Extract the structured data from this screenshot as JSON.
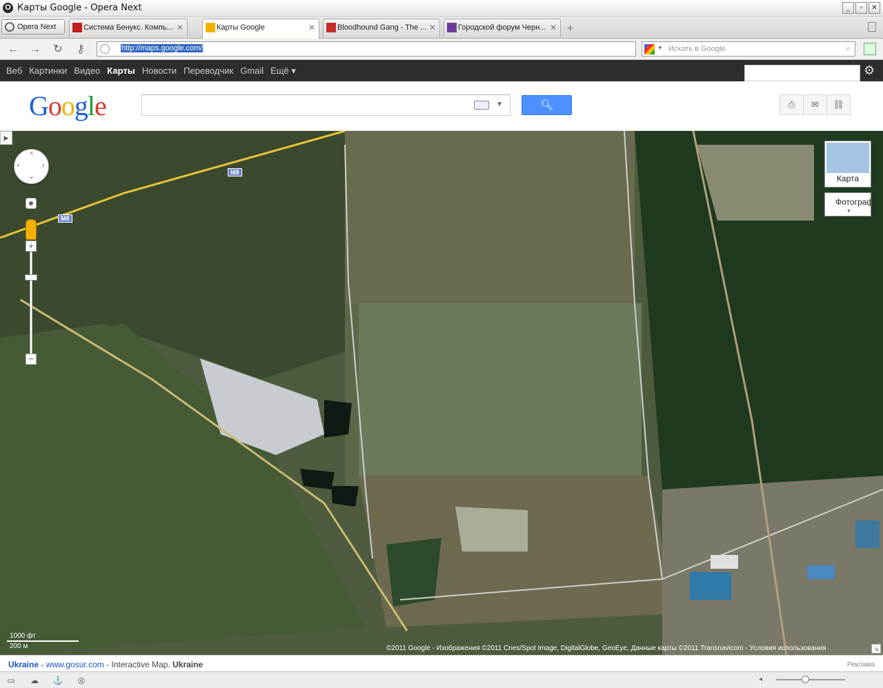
{
  "window": {
    "title": "Карты Google - Opera Next"
  },
  "tabs": {
    "menu_label": "Opera Next",
    "items": [
      {
        "label": "Система Бенукс. Компь...",
        "favicon_color": "#c41e1e"
      },
      {
        "label": "Карты Google",
        "favicon_color": "#f0b400"
      },
      {
        "label": "Bloodhound Gang - The ...",
        "favicon_color": "#c4302b"
      },
      {
        "label": "Городской форум Черн...",
        "favicon_color": "#6a3f9c"
      }
    ]
  },
  "address_bar": {
    "url": "http://maps.google.com/",
    "search_placeholder": "Искать в Google"
  },
  "google_bar": {
    "links": [
      "Веб",
      "Картинки",
      "Видео",
      "Карты",
      "Новости",
      "Переводчик",
      "Gmail",
      "Ещё ▾"
    ],
    "active": "Карты"
  },
  "header": {
    "logo": [
      "G",
      "o",
      "o",
      "g",
      "l",
      "e"
    ],
    "search_value": ""
  },
  "map": {
    "maptype_map_label": "Карта",
    "maptype_photo_label": "Фотограф",
    "road_label_1": "M8",
    "road_label_2": "M8",
    "scale_top": "1000 фт",
    "scale_bottom": "200 м",
    "copyright": "©2011 Google - Изображения ©2011 Cnes/Spot Image, DigitalGlobe, GeoEye, Данные карты ©2011 Transnavicom - Условия использования"
  },
  "ad": {
    "country": "Ukraine",
    "sep1": " - ",
    "site": "www.gosur.com",
    "text": " - Interactive Map. ",
    "country2": "Ukraine",
    "label": "Реклама"
  },
  "colors": {
    "accent": "#4d90fe",
    "gbar": "#2d2d2d"
  }
}
